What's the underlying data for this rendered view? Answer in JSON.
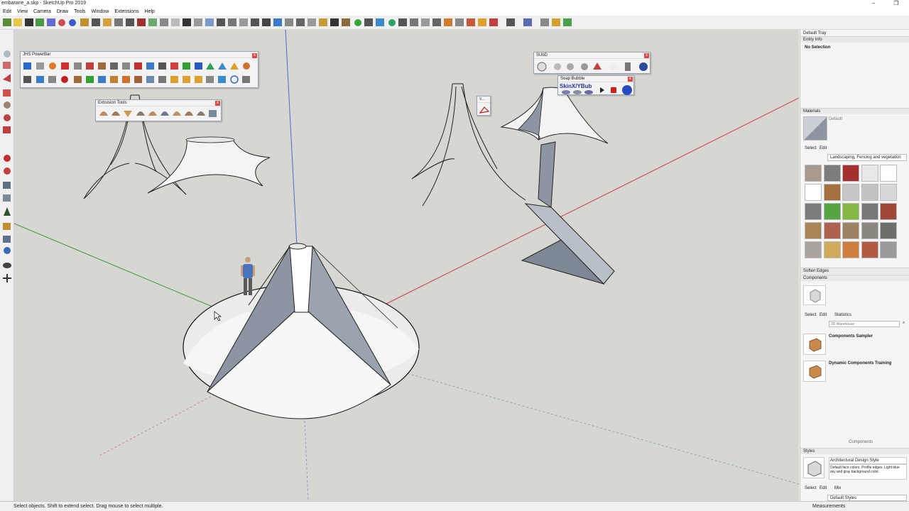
{
  "window": {
    "title": "embarane_a.skp - SketchUp Pro 2019",
    "minimize": "–",
    "maximize": "❐"
  },
  "menu": [
    "Edit",
    "View",
    "Camera",
    "Draw",
    "Tools",
    "Window",
    "Extensions",
    "Help"
  ],
  "floating_toolbars": {
    "powerbar": {
      "title": "JHS PowerBar"
    },
    "extrusion": {
      "title": "Extrusion Tools"
    },
    "subd": {
      "title": "SUbD"
    },
    "soap": {
      "title": "Soap Bubble",
      "label": "SkinX/YBub"
    },
    "mini": {
      "title": "V..."
    }
  },
  "tray": {
    "title": "Default Tray",
    "entity_info": {
      "header": "Entity Info",
      "value": "No Selection"
    },
    "materials": {
      "header": "Materials",
      "current": "Default",
      "tabs": [
        "Select",
        "Edit"
      ],
      "library": "Landscaping, Fencing and vegetation",
      "swatch_colors": [
        [
          "#a99a8f",
          "#7c7c7c",
          "#a3302d",
          "#e8e8e8",
          "#ffffff"
        ],
        [
          "#ffffff",
          "#a4703e",
          "#c7c7c7",
          "#c2c2c2",
          "#d8d8d8"
        ],
        [
          "#7b7b7b",
          "#56a540",
          "#86b845",
          "#777777",
          "#a14738"
        ],
        [
          "#a88457",
          "#b0604e",
          "#9b8363",
          "#8a8680",
          "#6f6d69"
        ],
        [
          "#a9a49c",
          "#d0aa5d",
          "#ce7f3c",
          "#b35a45",
          "#9a9a9a"
        ]
      ]
    },
    "soften_edges": {
      "header": "Soften Edges"
    },
    "components": {
      "header": "Components",
      "tabs": [
        "Select",
        "Edit",
        "Statistics"
      ],
      "search_placeholder": "3D Warehouse",
      "items": [
        {
          "name": "Components Sampler"
        },
        {
          "name": "Dynamic Components Training"
        }
      ],
      "footer": "Components"
    },
    "styles": {
      "header": "Styles",
      "style_name": "Architectural Design Style",
      "style_desc": "Default face colors. Profile edges. Light blue sky and gray background color.",
      "tabs": [
        "Select",
        "Edit",
        "Mix"
      ],
      "collection": "Default Styles"
    }
  },
  "status": {
    "message": "Select objects. Shift to extend select. Drag mouse to select multiple.",
    "measurements_label": "Measurements"
  },
  "colors": {
    "viewport_bg": "#d6d6d2",
    "axis_red": "#d04040",
    "axis_green": "#3a9a3a",
    "axis_blue": "#4a6ad0",
    "tent_face": "#f2f2f2",
    "tent_shadow": "#8c95a1"
  }
}
